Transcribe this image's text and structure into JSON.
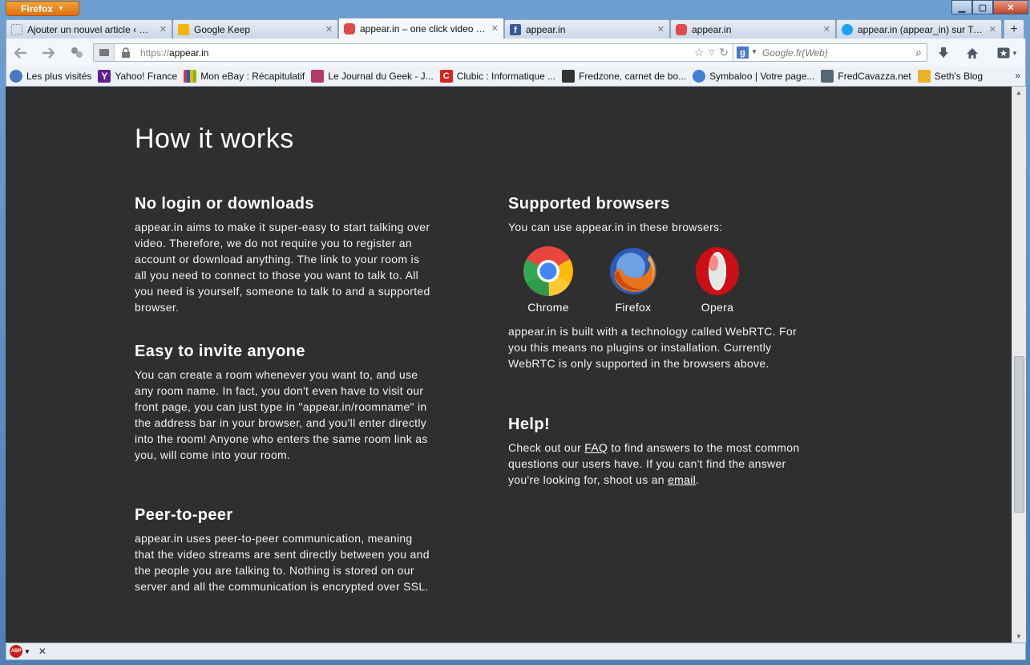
{
  "window": {
    "app_button": "Firefox",
    "controls": {
      "minimize": "▁",
      "maximize": "▢",
      "close": "✕"
    }
  },
  "tabs": [
    {
      "label": "Ajouter un nouvel article ‹ XY...",
      "icon_color": "#ffffff",
      "active": false
    },
    {
      "label": "Google Keep",
      "icon_color": "#f5b400",
      "active": false
    },
    {
      "label": "appear.in – one click video c...",
      "icon_color": "#e24a4a",
      "active": true
    },
    {
      "label": "appear.in",
      "icon_color": "#3b5998",
      "active": false
    },
    {
      "label": "appear.in",
      "icon_color": "#e24a4a",
      "active": false
    },
    {
      "label": "appear.in (appear_in) sur Twi...",
      "icon_color": "#1da1f2",
      "active": false
    }
  ],
  "toolbar": {
    "url_prefix": "https://",
    "url_host": "appear.in",
    "search_placeholder": "Google.fr(Web)"
  },
  "bookmarks": [
    {
      "label": "Les plus visités",
      "icon_color": "#4a78c0"
    },
    {
      "label": "Yahoo! France",
      "icon_color": "#5f1f8f"
    },
    {
      "label": "Mon eBay : Récapitulatif",
      "icon_color": "#e53238"
    },
    {
      "label": "Le Journal du Geek - J...",
      "icon_color": "#b03a6a"
    },
    {
      "label": "Clubic : Informatique ...",
      "icon_color": "#d6251f"
    },
    {
      "label": "Fredzone, carnet de bo...",
      "icon_color": "#333333"
    },
    {
      "label": "Symbaloo | Votre page...",
      "icon_color": "#3d7fd6"
    },
    {
      "label": "FredCavazza.net",
      "icon_color": "#556677"
    },
    {
      "label": "Seth's Blog",
      "icon_color": "#e7b32b"
    }
  ],
  "bookmarks_more": "»",
  "page": {
    "title": "How it works",
    "left_sections": [
      {
        "heading": "No login or downloads",
        "body": "appear.in aims to make it super-easy to start talking over video. Therefore, we do not require you to register an account or download anything. The link to your room is all you need to connect to those you want to talk to. All you need is yourself, someone to talk to and a supported browser."
      },
      {
        "heading": "Easy to invite anyone",
        "body": "You can create a room whenever you want to, and use any room name. In fact, you don't even have to visit our front page, you can just type in \"appear.in/roomname\" in the address bar in your browser, and you'll enter directly into the room! Anyone who enters the same room link as you, will come into your room."
      },
      {
        "heading": "Peer-to-peer",
        "body": "appear.in uses peer-to-peer communication, meaning that the video streams are sent directly between you and the people you are talking to. Nothing is stored on our server and all the communication is encrypted over SSL."
      }
    ],
    "supported": {
      "heading": "Supported browsers",
      "intro": "You can use appear.in in these browsers:",
      "browsers": [
        "Chrome",
        "Firefox",
        "Opera"
      ],
      "body": "appear.in is built with a technology called WebRTC. For you this means no plugins or installation. Currently WebRTC is only supported in the browsers above."
    },
    "help": {
      "heading": "Help!",
      "text1": "Check out our ",
      "faq_link": "FAQ",
      "text2": " to find answers to the most common questions our users have. If you can't find the answer you're looking for, shoot us an ",
      "email_link": "email",
      "text3": "."
    }
  },
  "statusbar": {
    "abp_label": "ABP",
    "close": "✕"
  },
  "colors": {
    "page_bg": "#2f2f2f",
    "accent": "#e06f0c"
  }
}
